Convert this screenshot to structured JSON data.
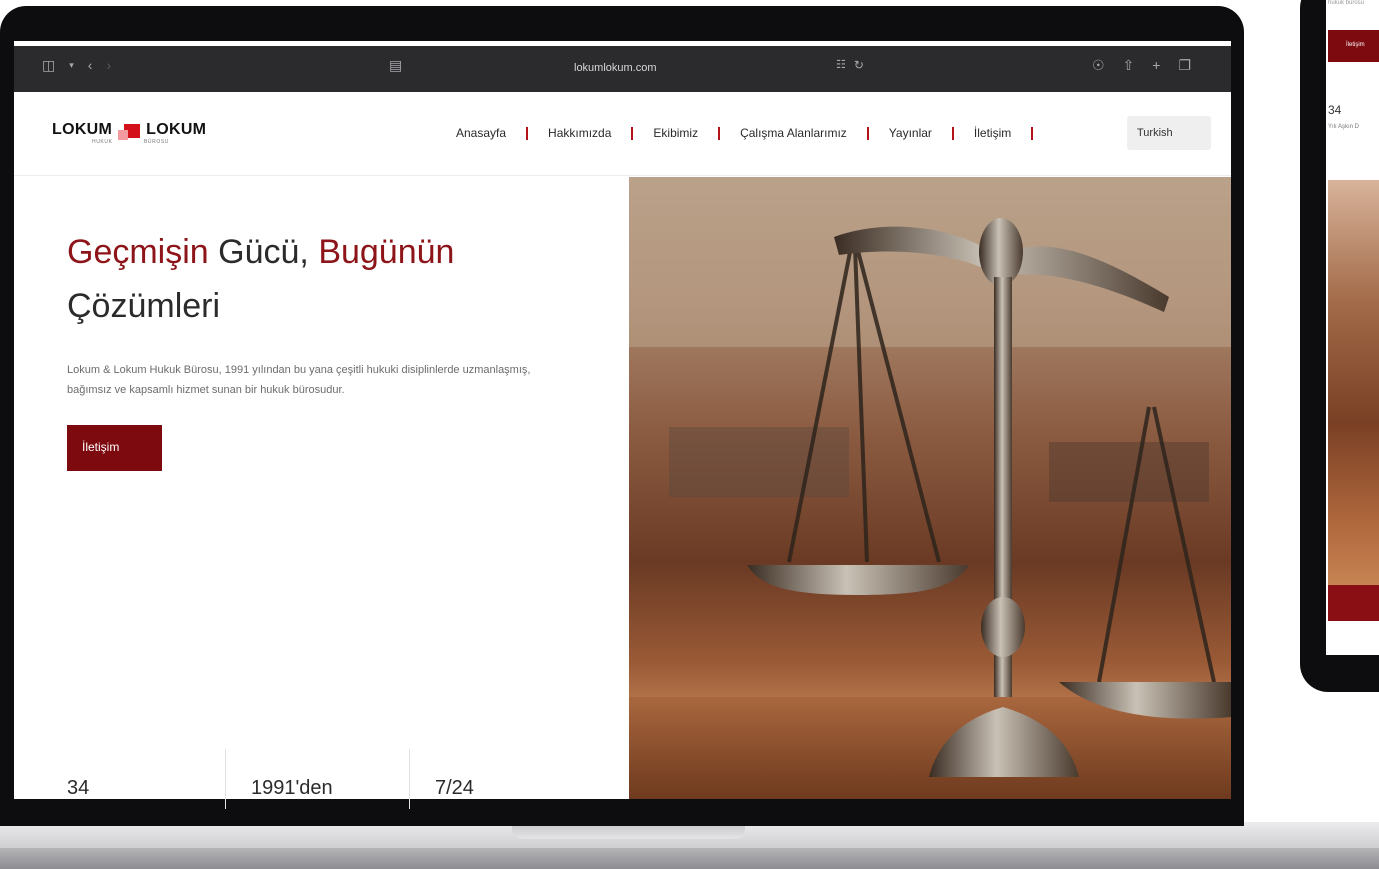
{
  "browser": {
    "url": "lokumlokum.com",
    "icons": [
      "sidebar-icon",
      "chevron-down-icon",
      "back-icon",
      "forward-icon",
      "page-icon",
      "translate-icon",
      "reload-icon",
      "download-icon",
      "share-icon",
      "new-tab-icon",
      "tabs-icon"
    ]
  },
  "site": {
    "logo_left": "LOKUM",
    "logo_right": "LOKUM",
    "logo_sub_left": "HUKUK",
    "logo_sub_right": "BÜROSU",
    "nav": [
      "Anasayfa",
      "Hakkımızda",
      "Ekibimiz",
      "Çalışma Alanlarımız",
      "Yayınlar",
      "İletişim"
    ],
    "language": "Turkish"
  },
  "hero": {
    "headline_1": "Geçmişin",
    "headline_2": " Gücü, ",
    "headline_3": "Bugünün",
    "headline_4": "Çözümleri",
    "lead": "Lokum & Lokum Hukuk Bürosu, 1991 yılından bu yana çeşitli hukuki disiplinlerde uzmanlaşmış, bağımsız ve kapsamlı hizmet sunan bir hukuk bürosudur.",
    "cta": "İletişim",
    "stats": [
      "34",
      "1991'den",
      "7/24"
    ]
  },
  "tablet": {
    "top_text": "hukuk bürosu",
    "cta": "İletişim",
    "stat": "34",
    "stat_sub": "Yılı Aşkın D"
  },
  "colors": {
    "brand_red": "#8d1418",
    "cta_red": "#7d0a0e",
    "logo_red": "#d2111b",
    "nav_separator": "#b3121a"
  }
}
